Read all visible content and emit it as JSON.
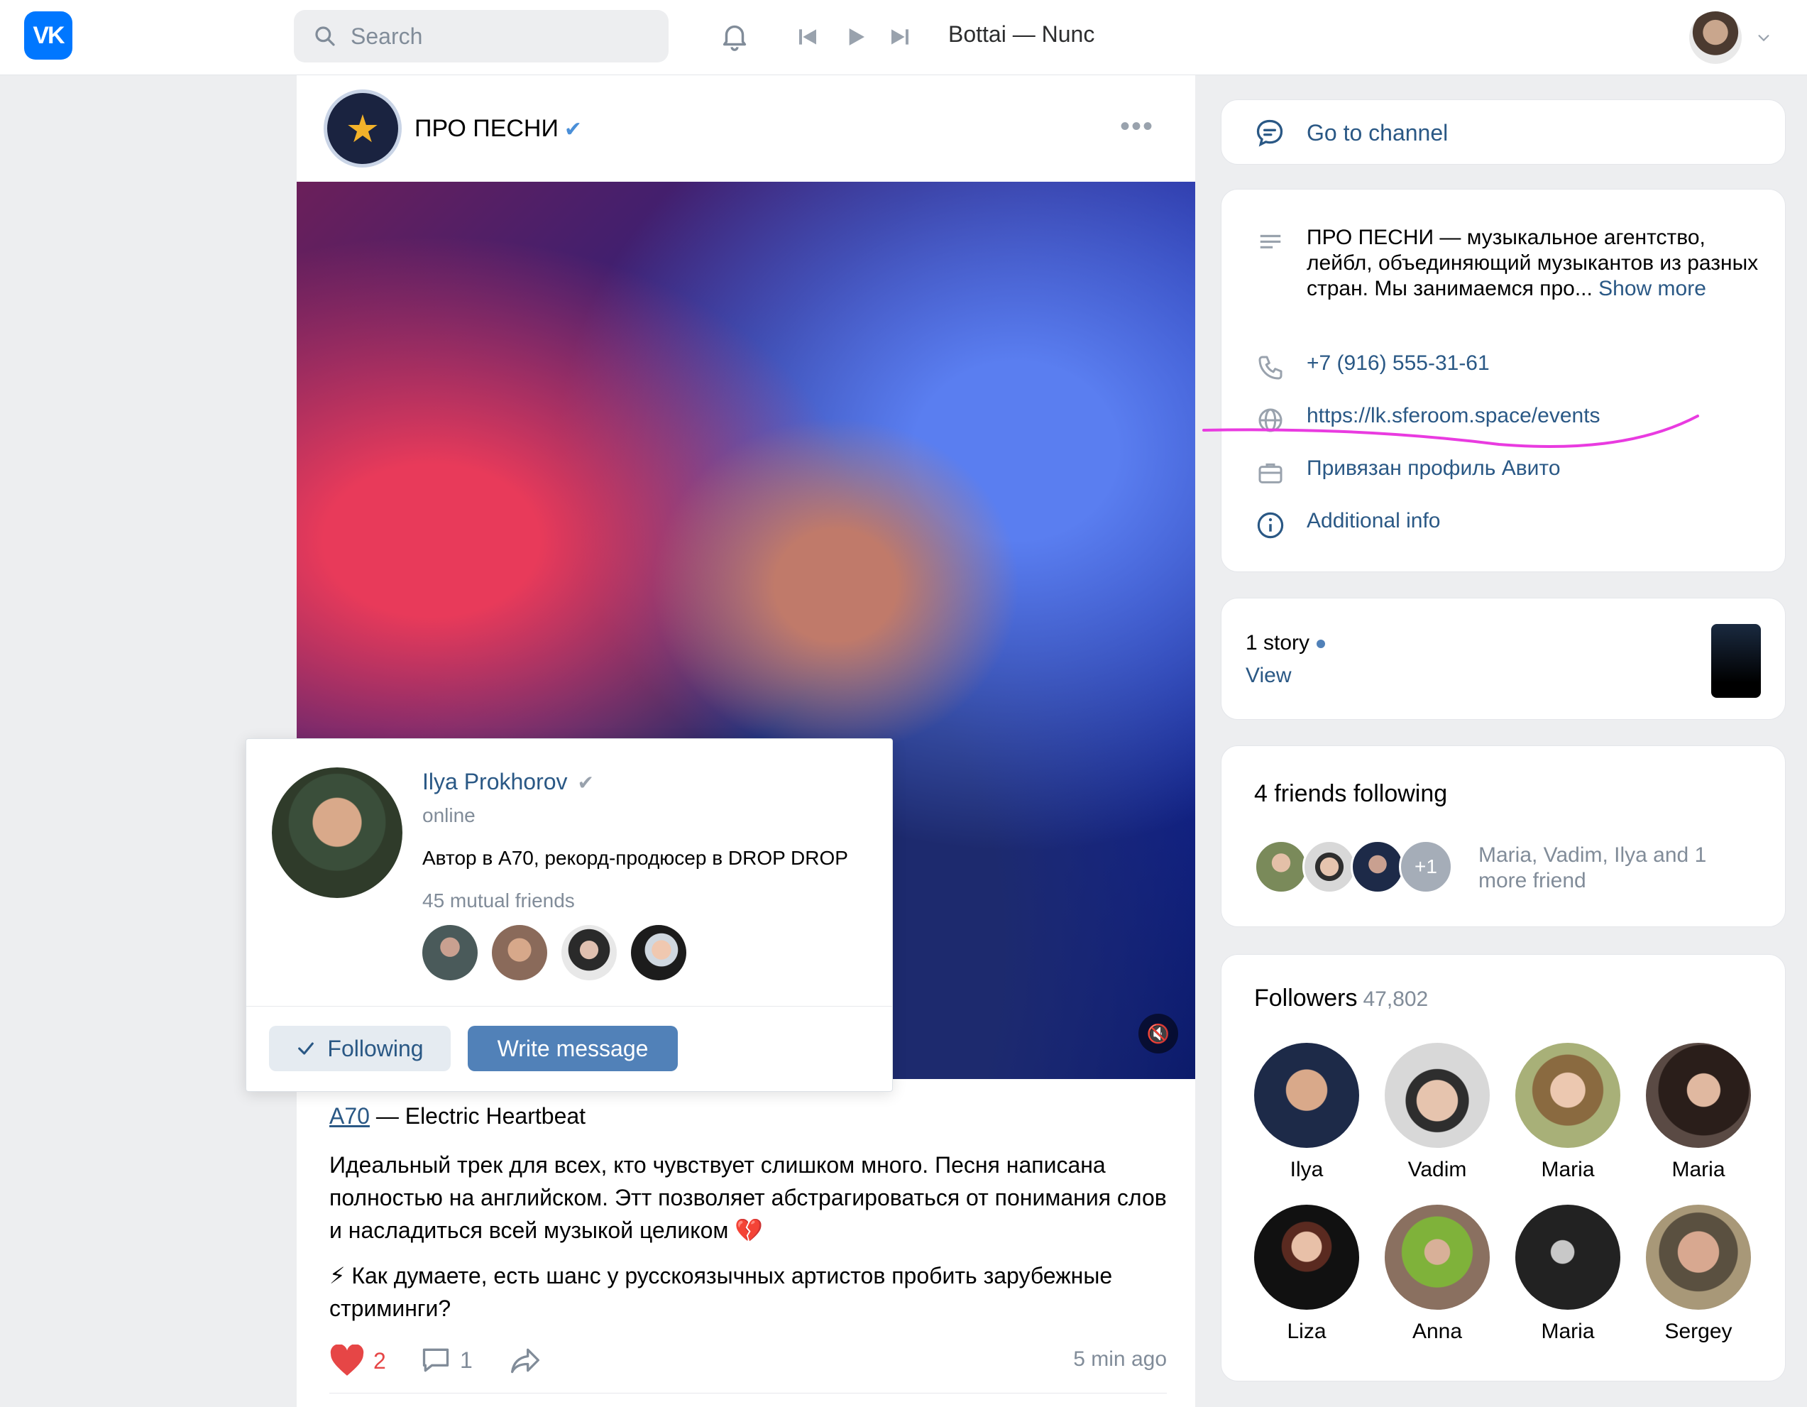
{
  "topbar": {
    "logo_text": "VK",
    "search_placeholder": "Search",
    "now_playing": "Bottai — Nunc"
  },
  "post": {
    "channel_name": "ПРО ПЕСНИ",
    "track_artist": "A70",
    "track_title": " — Electric Heartbeat",
    "text_p1": "Идеальный трек для всех, кто чувствует слишком много. Песня написана полностью на английском. Этт позволяет абстрагироваться от понимания слов и насладиться всей музыкой целиком 💔",
    "text_p2": "⚡ Как думаете, есть шанс у русскоязычных артистов пробить зарубежные стриминги?",
    "likes": "2",
    "comments": "1",
    "time": "5 min ago"
  },
  "popup": {
    "name": "Ilya Prokhorov",
    "status": "online",
    "bio": "Автор в A70, рекорд-продюсер в DROP DROP",
    "mutual": "45 mutual friends",
    "following_label": "Following",
    "write_label": "Write message"
  },
  "sidebar": {
    "go_to_channel": "Go to channel",
    "description": "ПРО ПЕСНИ — музыкальное агентство, лейбл, объединяющий музыкантов из разных стран. Мы занимаемся про...",
    "show_more": "Show more",
    "phone": "+7 (916) 555-31-61",
    "website": "https://lk.sferoom.space/events",
    "avito": "Привязан профиль Авито",
    "additional": "Additional info",
    "stories_count": "1 story",
    "stories_view": "View",
    "friends_title": "4 friends following",
    "friends_plus": "+1",
    "friends_names": "Maria, Vadim, Ilya and 1 more friend",
    "followers_title": "Followers",
    "followers_count": "47,802",
    "followers": [
      {
        "name": "Ilya"
      },
      {
        "name": "Vadim"
      },
      {
        "name": "Maria"
      },
      {
        "name": "Maria"
      },
      {
        "name": "Liza"
      },
      {
        "name": "Anna"
      },
      {
        "name": "Maria"
      },
      {
        "name": "Sergey"
      }
    ]
  },
  "colors": {
    "accent": "#2a5885",
    "button": "#5181b8",
    "highlight_stroke": "#e93be0"
  }
}
